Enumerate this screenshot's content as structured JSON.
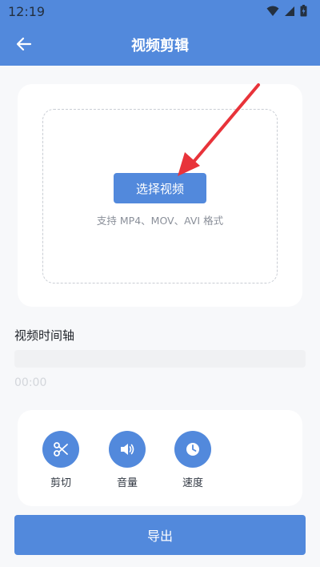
{
  "status_bar": {
    "time": "12:19"
  },
  "header": {
    "title": "视频剪辑"
  },
  "upload": {
    "select_button_label": "选择视频",
    "format_hint": "支持 MP4、MOV、AVI 格式"
  },
  "timeline": {
    "title": "视频时间轴",
    "current_time": "00:00"
  },
  "tools": [
    {
      "label": "剪切",
      "icon": "scissors-icon"
    },
    {
      "label": "音量",
      "icon": "volume-icon"
    },
    {
      "label": "速度",
      "icon": "clock-icon"
    }
  ],
  "export_button_label": "导出",
  "colors": {
    "primary": "#5289dc",
    "background": "#f7f8fa",
    "card": "#ffffff",
    "annotation_arrow": "#e8333a"
  }
}
